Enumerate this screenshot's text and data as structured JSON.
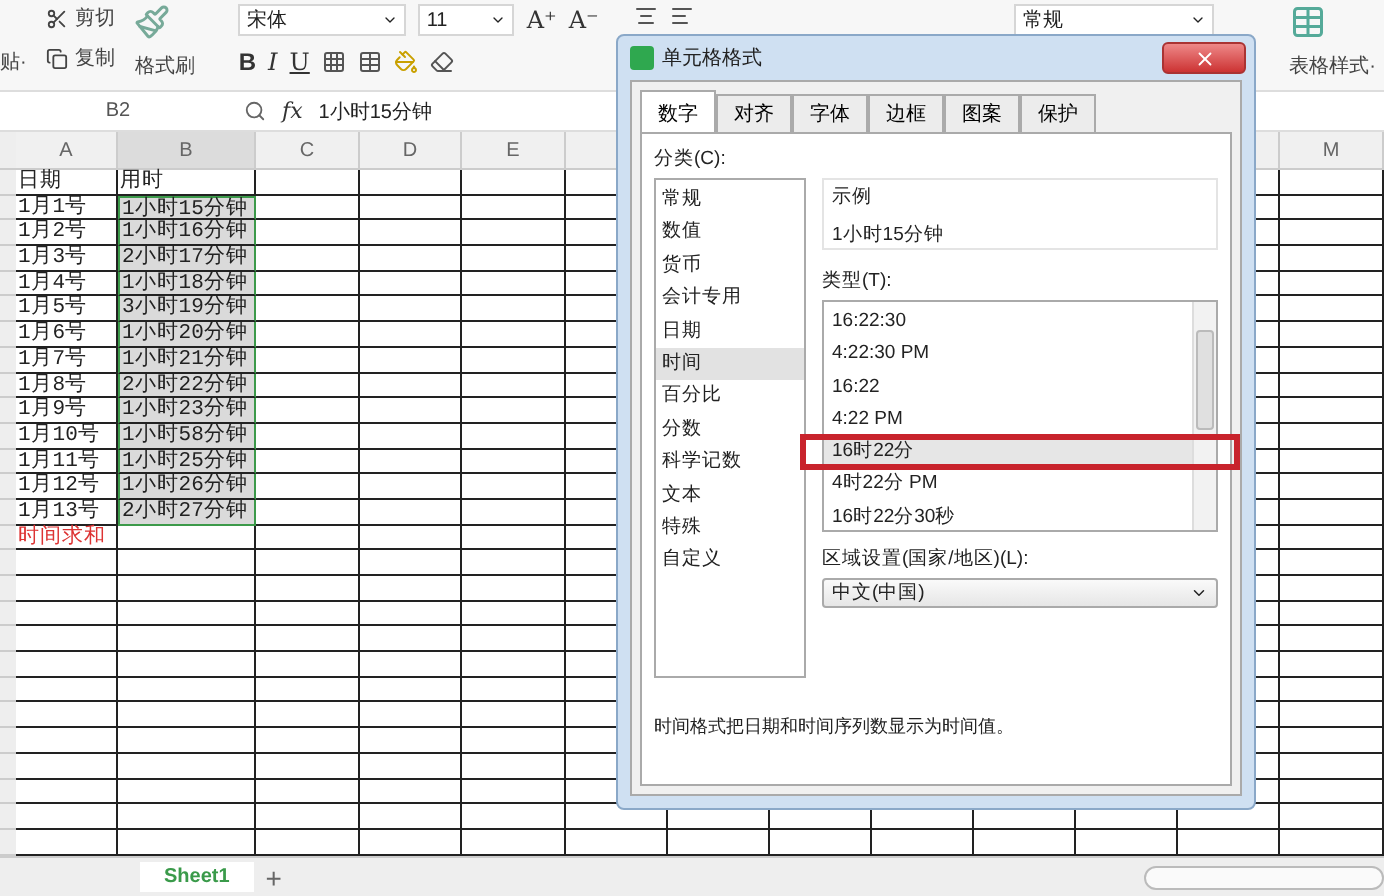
{
  "ribbon": {
    "paste_label": "贴·",
    "cut": "剪切",
    "copy": "复制",
    "format_painter": "格式刷",
    "font": "宋体",
    "font_size": "11",
    "grow_font": "A⁺",
    "shrink_font": "A⁻",
    "bold": "B",
    "italic": "I",
    "underline": "U",
    "number_format": "常规",
    "table_style": "表格样式·"
  },
  "formula_bar": {
    "cell_ref": "B2",
    "fx": "fx",
    "value": "1小时15分钟"
  },
  "columns": [
    {
      "label": "A",
      "selected": false
    },
    {
      "label": "B",
      "selected": true
    },
    {
      "label": "C",
      "selected": false
    },
    {
      "label": "D",
      "selected": false
    },
    {
      "label": "E",
      "selected": false
    },
    {
      "label": "M",
      "selected": false
    }
  ],
  "rows": [
    {
      "a": "日期",
      "b": "用时",
      "kind": "header"
    },
    {
      "a": "1月1号",
      "b": "1小时15分钟",
      "kind": "data"
    },
    {
      "a": "1月2号",
      "b": "1小时16分钟",
      "kind": "data"
    },
    {
      "a": "1月3号",
      "b": "2小时17分钟",
      "kind": "data"
    },
    {
      "a": "1月4号",
      "b": "1小时18分钟",
      "kind": "data"
    },
    {
      "a": "1月5号",
      "b": "3小时19分钟",
      "kind": "data"
    },
    {
      "a": "1月6号",
      "b": "1小时20分钟",
      "kind": "data"
    },
    {
      "a": "1月7号",
      "b": "1小时21分钟",
      "kind": "data"
    },
    {
      "a": "1月8号",
      "b": "2小时22分钟",
      "kind": "data"
    },
    {
      "a": "1月9号",
      "b": "1小时23分钟",
      "kind": "data"
    },
    {
      "a": "1月10号",
      "b": "1小时58分钟",
      "kind": "data"
    },
    {
      "a": "1月11号",
      "b": "1小时25分钟",
      "kind": "data"
    },
    {
      "a": "1月12号",
      "b": "1小时26分钟",
      "kind": "data"
    },
    {
      "a": "1月13号",
      "b": "2小时27分钟",
      "kind": "data"
    },
    {
      "a": "时间求和",
      "kind": "total"
    }
  ],
  "sheet_tabs": [
    {
      "label": "Sheet1",
      "selected": true
    }
  ],
  "add_sheet": "+",
  "dialog": {
    "title": "单元格格式",
    "tabs": [
      {
        "label": "数字",
        "selected": true
      },
      {
        "label": "对齐",
        "selected": false
      },
      {
        "label": "字体",
        "selected": false
      },
      {
        "label": "边框",
        "selected": false
      },
      {
        "label": "图案",
        "selected": false
      },
      {
        "label": "保护",
        "selected": false
      }
    ],
    "category_label": "分类(C):",
    "categories": [
      {
        "label": "常规",
        "selected": false
      },
      {
        "label": "数值",
        "selected": false
      },
      {
        "label": "货币",
        "selected": false
      },
      {
        "label": "会计专用",
        "selected": false
      },
      {
        "label": "日期",
        "selected": false
      },
      {
        "label": "时间",
        "selected": true
      },
      {
        "label": "百分比",
        "selected": false
      },
      {
        "label": "分数",
        "selected": false
      },
      {
        "label": "科学记数",
        "selected": false
      },
      {
        "label": "文本",
        "selected": false
      },
      {
        "label": "特殊",
        "selected": false
      },
      {
        "label": "自定义",
        "selected": false
      }
    ],
    "sample_label": "示例",
    "sample_value": "1小时15分钟",
    "type_label": "类型(T):",
    "types": [
      {
        "label": "16:22:30",
        "selected": false
      },
      {
        "label": "4:22:30 PM",
        "selected": false
      },
      {
        "label": "16:22",
        "selected": false
      },
      {
        "label": "4:22 PM",
        "selected": false
      },
      {
        "label": "16时22分",
        "selected": true,
        "highlighted": true
      },
      {
        "label": "4时22分 PM",
        "selected": false
      },
      {
        "label": "16时22分30秒",
        "selected": false
      }
    ],
    "locale_label": "区域设置(国家/地区)(L):",
    "locale_value": "中文(中国)",
    "description": "时间格式把日期和时间序列数显示为时间值。"
  }
}
